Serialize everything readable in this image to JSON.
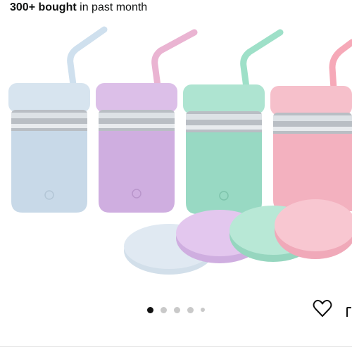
{
  "purchase_banner": {
    "count": "300+ bought",
    "suffix": "in past month"
  },
  "product_image": {
    "description_icon": "kids-stainless-steel-cups-with-silicone-straw-lids",
    "cup_colors": [
      "#cbdce9",
      "#d4b4e4",
      "#9fdcc9",
      "#f4b6c3"
    ],
    "lid_colors": [
      "#d8e3ee",
      "#ddbfe9",
      "#b3e6d4",
      "#f8c3cd"
    ]
  },
  "carousel": {
    "total": 5,
    "active_index": 0
  },
  "actions": {
    "favorite_icon": "heart-icon",
    "share_icon": "share-icon"
  }
}
